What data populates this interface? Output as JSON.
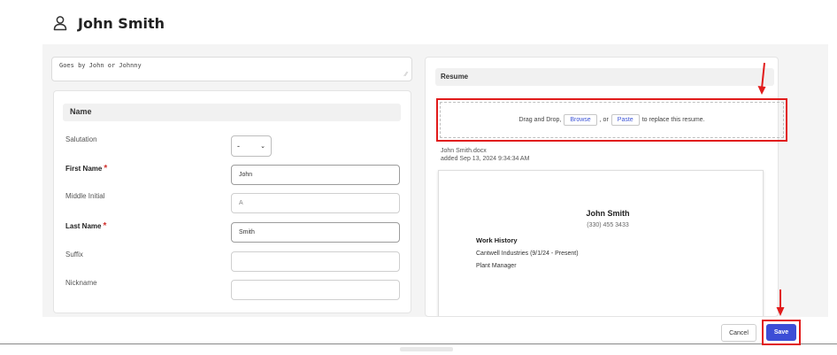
{
  "header": {
    "name": "John Smith",
    "icon": "person-icon"
  },
  "notes": {
    "text": "Goes by John or Johnny"
  },
  "name_section": {
    "title": "Name",
    "salutation": {
      "label": "Salutation",
      "value": "-"
    },
    "first_name": {
      "label": "First Name",
      "required_mark": "*",
      "value": "John"
    },
    "middle_initial": {
      "label": "Middle Initial",
      "value": "A"
    },
    "last_name": {
      "label": "Last Name",
      "required_mark": "*",
      "value": "Smith"
    },
    "suffix": {
      "label": "Suffix",
      "value": ""
    },
    "nickname": {
      "label": "Nickname",
      "value": ""
    }
  },
  "resume": {
    "title": "Resume",
    "dropzone": {
      "prefix": "Drag and Drop,",
      "browse": "Browse",
      "or": ", or",
      "paste": "Paste",
      "suffix": "to replace this resume."
    },
    "file_name": "John Smith.docx",
    "file_added": "added Sep 13, 2024 9:34:34 AM",
    "preview": {
      "name": "John Smith",
      "phone": "(330) 455 3433",
      "section": "Work History",
      "line1": "Cantwell Industries (9/1/24 - Present)",
      "line2": "Plant Manager"
    }
  },
  "footer": {
    "cancel_label": "Cancel",
    "save_label": "Save"
  },
  "colors": {
    "accent": "#3d4ed6",
    "highlight": "#e11b1b",
    "required": "#d0312d"
  }
}
